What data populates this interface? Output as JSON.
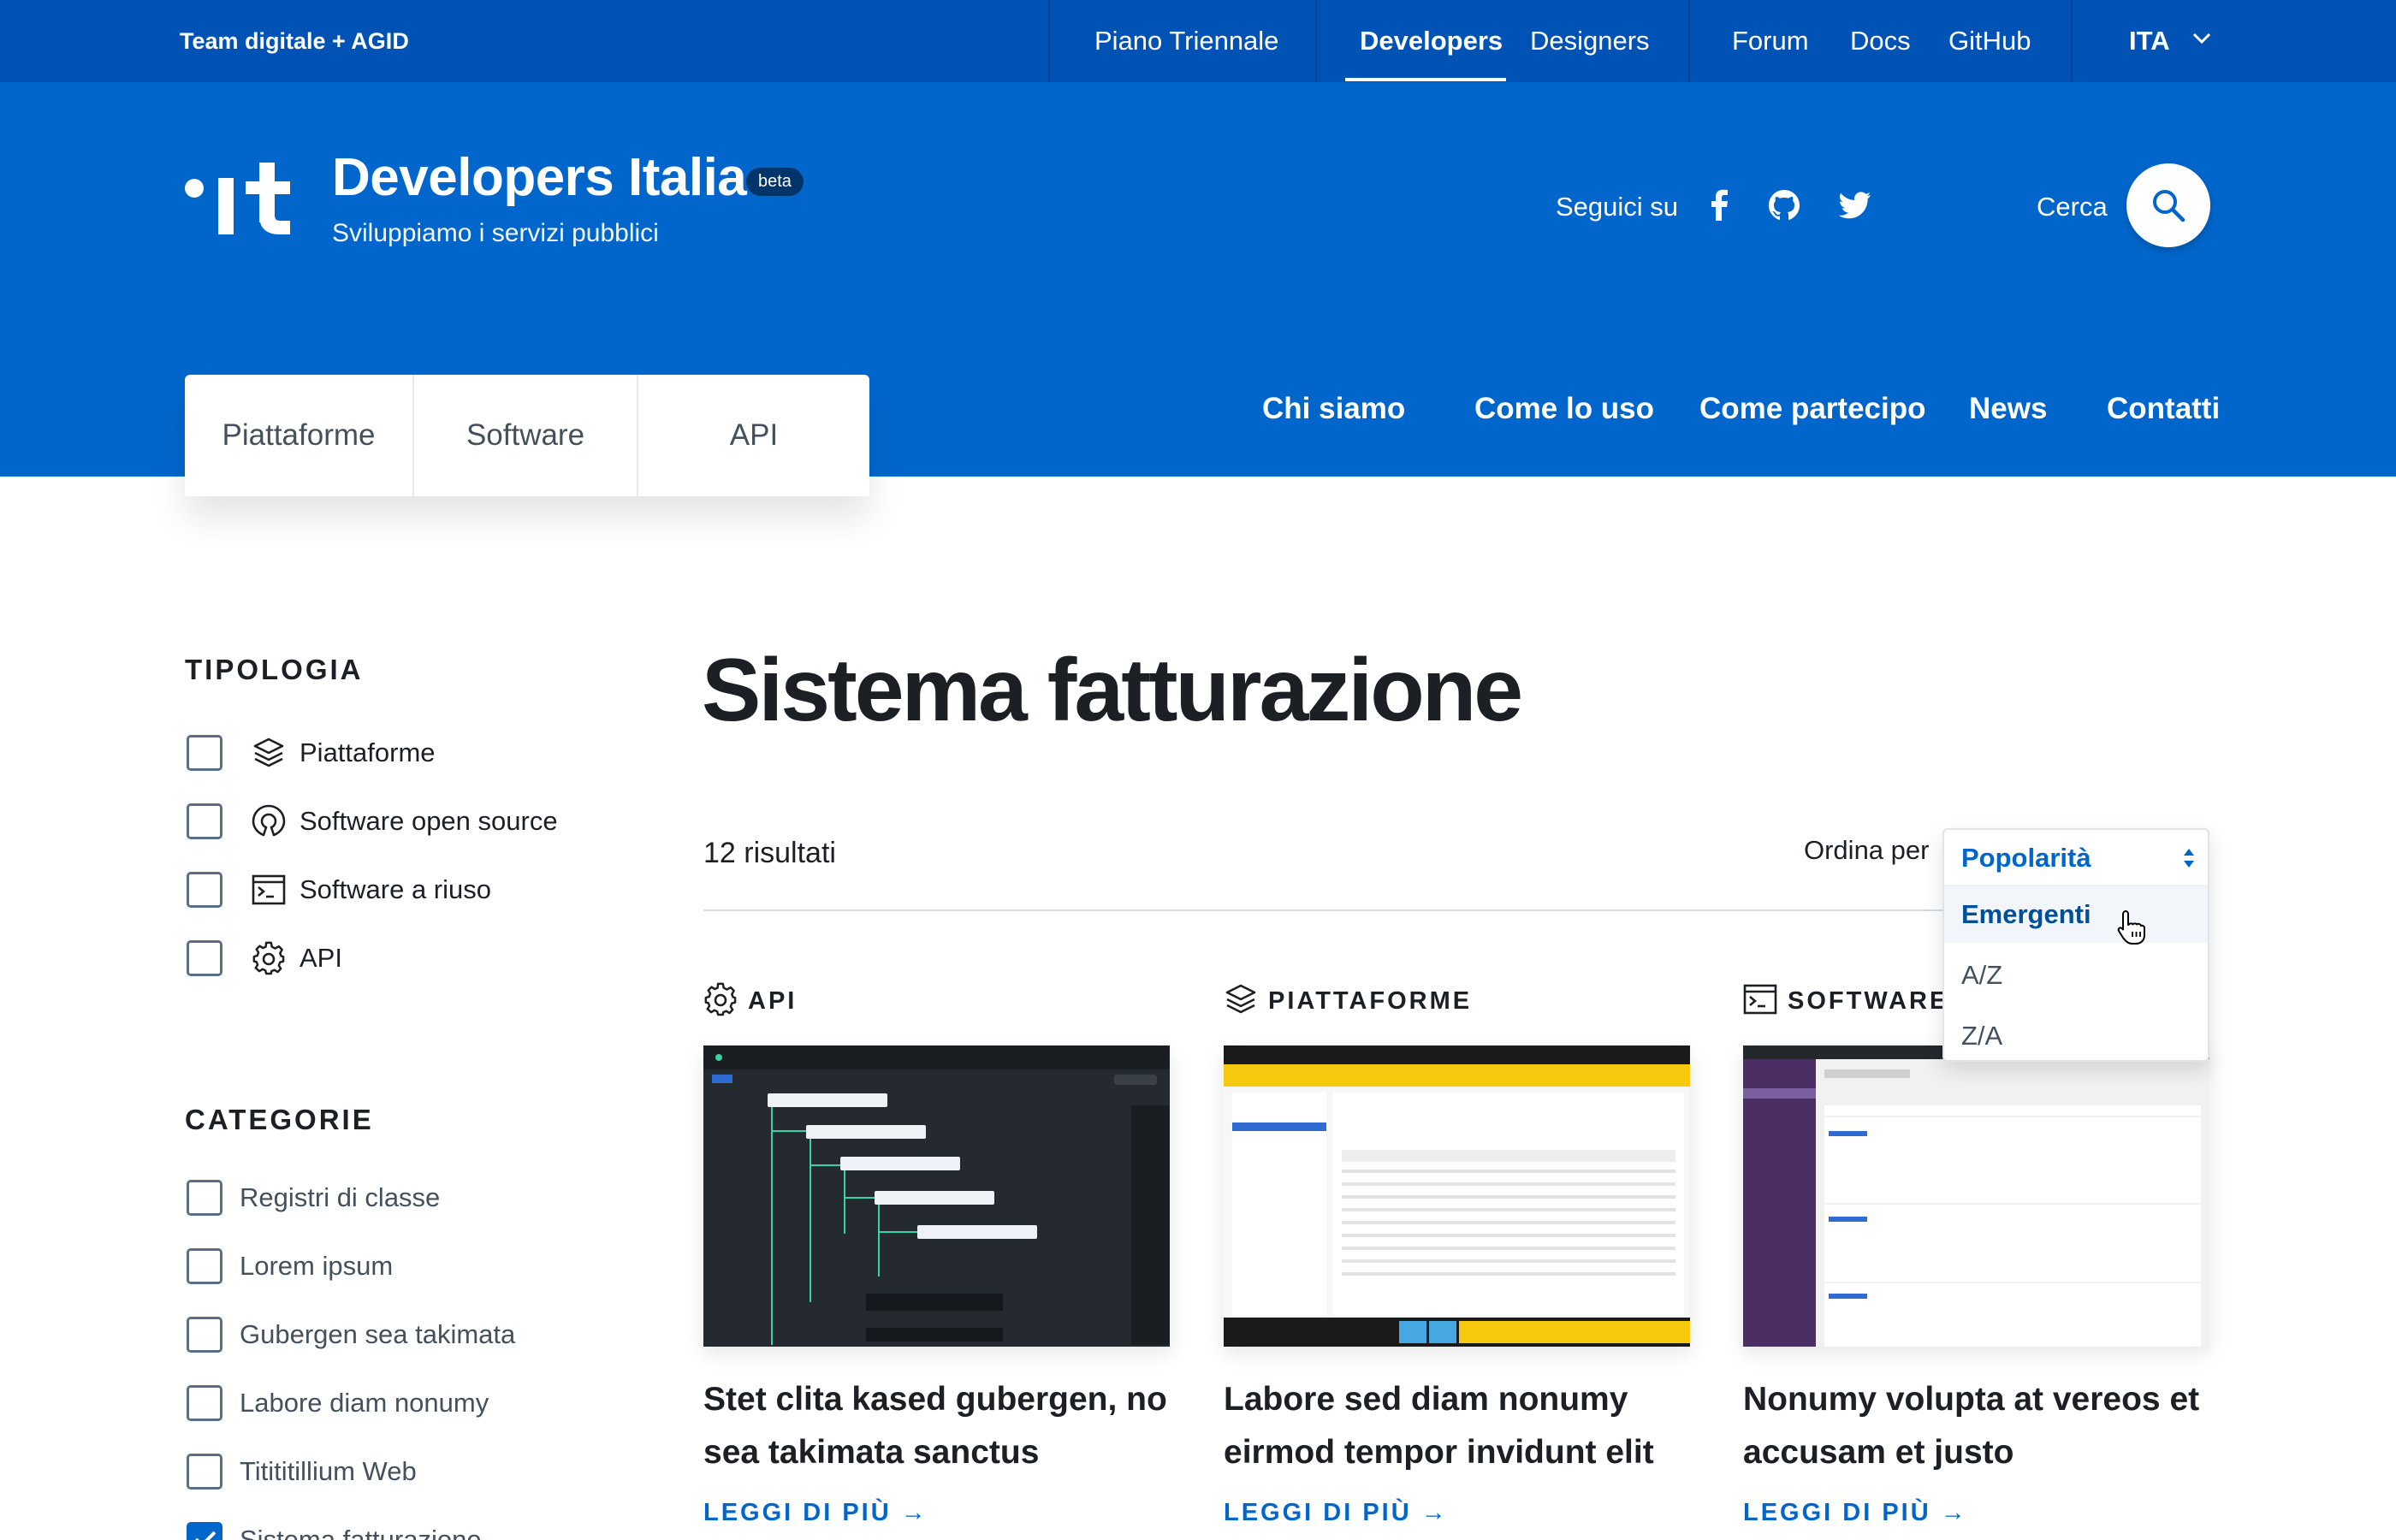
{
  "topbar": {
    "brand": "Team digitale + AGID",
    "links": [
      "Piano Triennale",
      "Developers",
      "Designers",
      "Forum",
      "Docs",
      "GitHub"
    ],
    "active": "Developers",
    "language": "ITA"
  },
  "header": {
    "site_title": "Developers Italia",
    "badge": "beta",
    "subtitle": "Sviluppiamo i servizi pubblici",
    "follow_label": "Seguici su",
    "social": [
      "facebook-icon",
      "github-icon",
      "twitter-icon"
    ],
    "search_label": "Cerca"
  },
  "tabs": [
    "Piattaforme",
    "Software",
    "API"
  ],
  "mainnav": [
    "Chi siamo",
    "Come lo uso",
    "Come partecipo",
    "News",
    "Contatti"
  ],
  "sidebar": {
    "tipologia_title": "TIPOLOGIA",
    "tipologia": [
      {
        "label": "Piattaforme",
        "icon": "layers-icon",
        "checked": false
      },
      {
        "label": "Software open source",
        "icon": "open-source-icon",
        "checked": false
      },
      {
        "label": "Software a riuso",
        "icon": "terminal-icon",
        "checked": false
      },
      {
        "label": "API",
        "icon": "gear-icon",
        "checked": false
      }
    ],
    "categorie_title": "CATEGORIE",
    "categorie": [
      {
        "label": "Registri di classe",
        "checked": false
      },
      {
        "label": "Lorem ipsum",
        "checked": false
      },
      {
        "label": "Gubergen sea takimata",
        "checked": false
      },
      {
        "label": "Labore diam nonumy",
        "checked": false
      },
      {
        "label": "Titititillium Web",
        "checked": false
      },
      {
        "label": "Sistema fatturazione",
        "checked": true
      }
    ]
  },
  "content": {
    "title": "Sistema fatturazione",
    "results": "12 risultati",
    "sort_label": "Ordina per",
    "sort": {
      "selected": "Popolarità",
      "options": [
        "Emergenti",
        "A/Z",
        "Z/A"
      ],
      "hovered": "Emergenti"
    },
    "cards": [
      {
        "category": "API",
        "icon": "gear-icon",
        "title": "Stet clita kased gubergen, no sea takimata sanctus",
        "more": "LEGGI DI PIÙ"
      },
      {
        "category": "PIATTAFORME",
        "icon": "layers-icon",
        "title": "Labore sed diam nonumy eirmod tempor invidunt elit",
        "more": "LEGGI DI PIÙ"
      },
      {
        "category": "SOFTWARE A RIUSO",
        "icon": "terminal-icon",
        "title": "Nonumy volupta at vereos et accusam et justo",
        "more": "LEGGI DI PIÙ"
      }
    ]
  },
  "colors": {
    "topbar": "#0052b5",
    "primary": "#0066cc",
    "text": "#1c2024",
    "muted": "#5c6f82"
  }
}
